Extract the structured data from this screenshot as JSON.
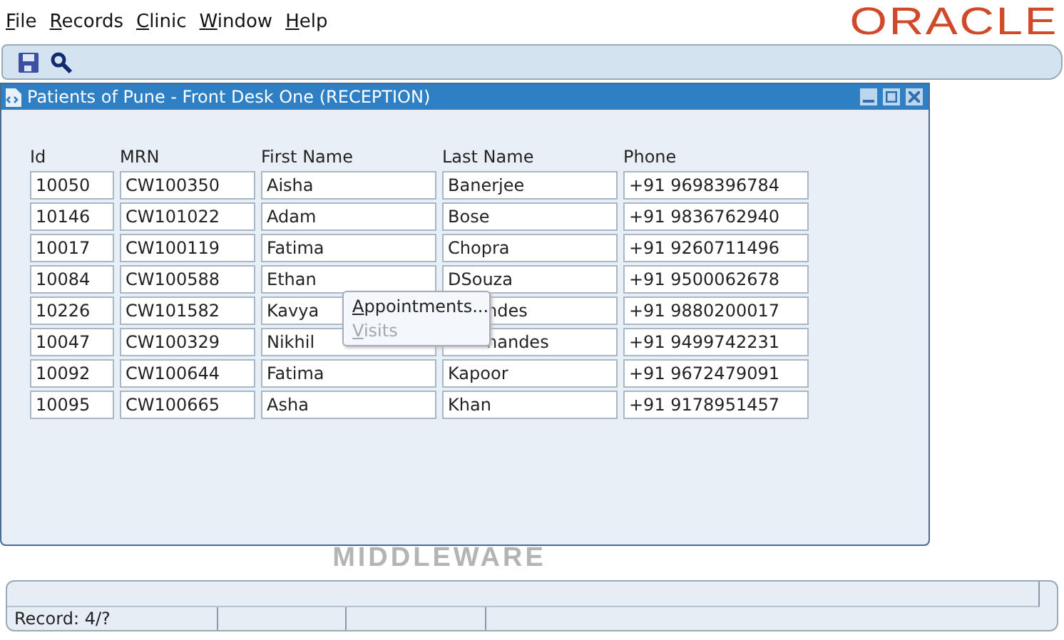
{
  "menu_bar": [
    {
      "label": "File"
    },
    {
      "label": "Records"
    },
    {
      "label": "Clinic"
    },
    {
      "label": "Window"
    },
    {
      "label": "Help"
    }
  ],
  "brand": "ORACLE",
  "background_caption": "MIDDLEWARE",
  "window": {
    "title": "Patients of Pune - Front Desk One (RECEPTION)"
  },
  "table": {
    "columns": [
      "Id",
      "MRN",
      "First Name",
      "Last Name",
      "Phone"
    ],
    "rows": [
      {
        "id": "10050",
        "mrn": "CW100350",
        "first_name": "Aisha",
        "last_name": "Banerjee",
        "phone": "+91 9698396784",
        "last_name_covered": false
      },
      {
        "id": "10146",
        "mrn": "CW101022",
        "first_name": "Adam",
        "last_name": "Bose",
        "phone": "+91 9836762940",
        "last_name_covered": false
      },
      {
        "id": "10017",
        "mrn": "CW100119",
        "first_name": "Fatima",
        "last_name": "Chopra",
        "phone": "+91 9260711496",
        "last_name_covered": false
      },
      {
        "id": "10084",
        "mrn": "CW100588",
        "first_name": "Ethan",
        "last_name": "DSouza",
        "phone": "+91 9500062678",
        "last_name_covered": false
      },
      {
        "id": "10226",
        "mrn": "CW101582",
        "first_name": "Kavya",
        "last_name": "ndes",
        "phone": "+91 9880200017",
        "last_name_covered": true
      },
      {
        "id": "10047",
        "mrn": "CW100329",
        "first_name": "Nikhil",
        "last_name": "nandes",
        "phone": "+91 9499742231",
        "last_name_covered": true
      },
      {
        "id": "10092",
        "mrn": "CW100644",
        "first_name": "Fatima",
        "last_name": "Kapoor",
        "phone": "+91 9672479091",
        "last_name_covered": false
      },
      {
        "id": "10095",
        "mrn": "CW100665",
        "first_name": "Asha",
        "last_name": "Khan",
        "phone": "+91 9178951457",
        "last_name_covered": false
      }
    ]
  },
  "context_menu": [
    {
      "label": "Appointments...",
      "disabled": false
    },
    {
      "label": "Visits",
      "disabled": true
    }
  ],
  "status_bar": {
    "record": "Record: 4/?"
  }
}
